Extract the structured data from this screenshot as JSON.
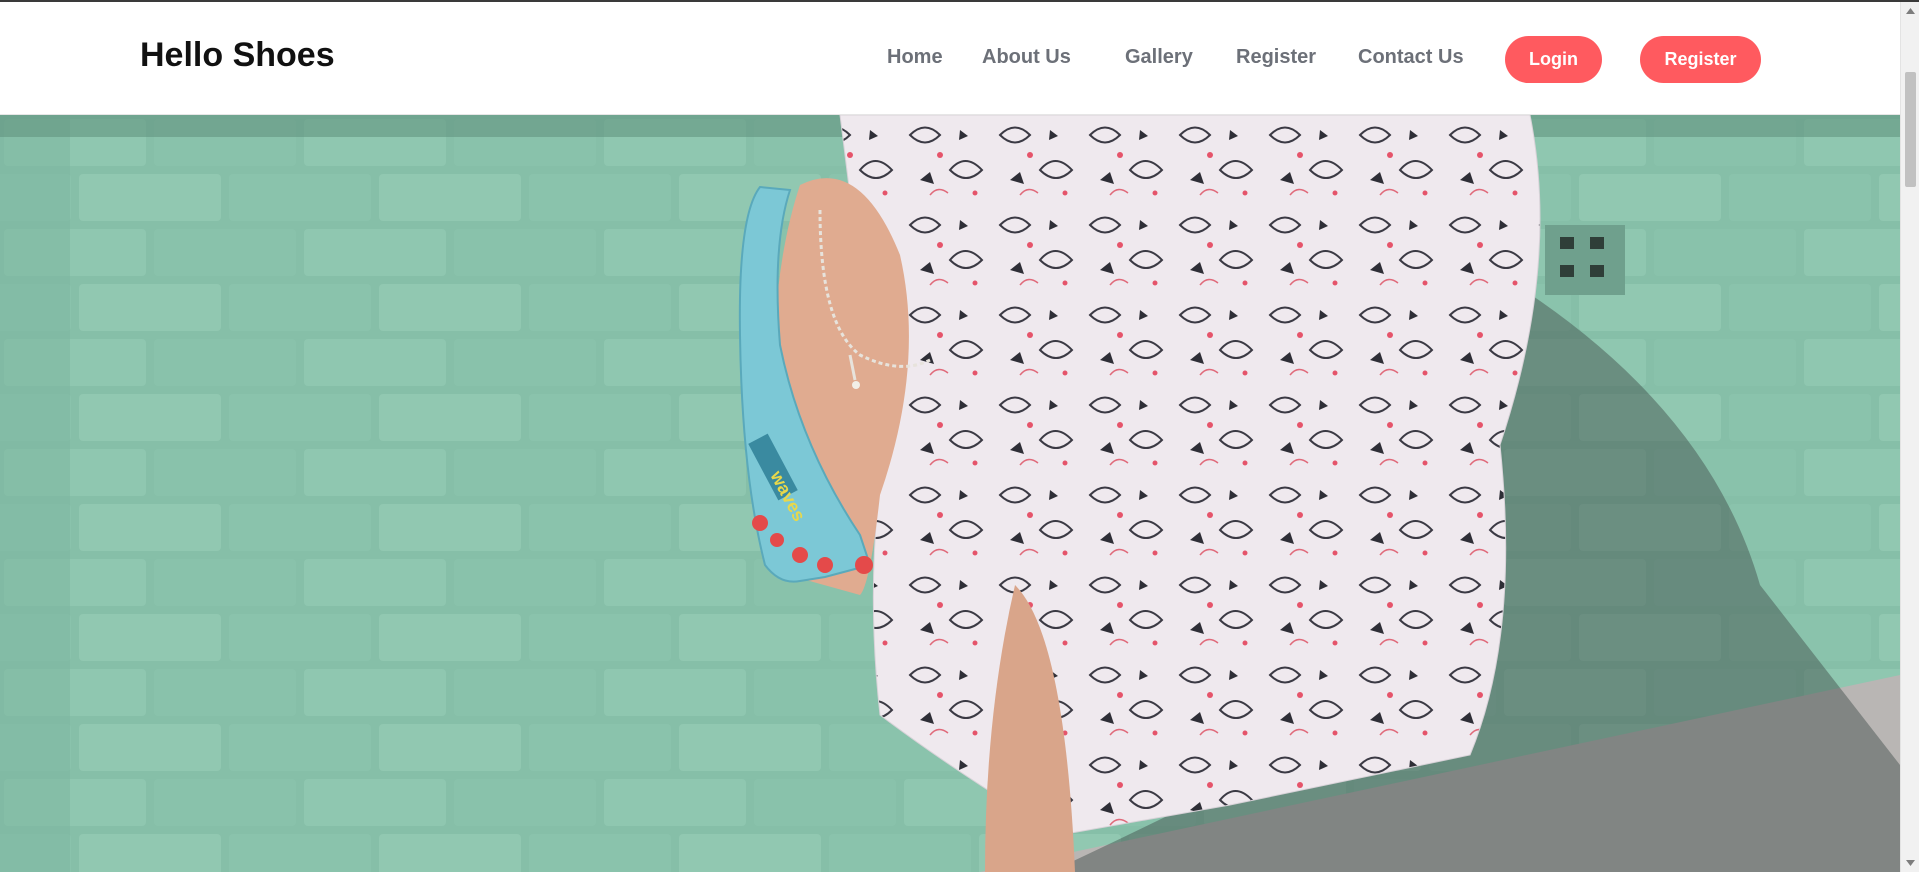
{
  "brand": {
    "title": "Hello Shoes"
  },
  "nav": {
    "links": [
      "Home",
      "About Us",
      "Gallery",
      "Register",
      "Contact Us"
    ]
  },
  "buttons": {
    "login": "Login",
    "register": "Register"
  },
  "hero": {
    "flipflop_text": "waves"
  },
  "colors": {
    "accent": "#ff5a5f",
    "nav_text": "#6c7078",
    "brand_text": "#111111",
    "wall": "#86bfa8"
  }
}
